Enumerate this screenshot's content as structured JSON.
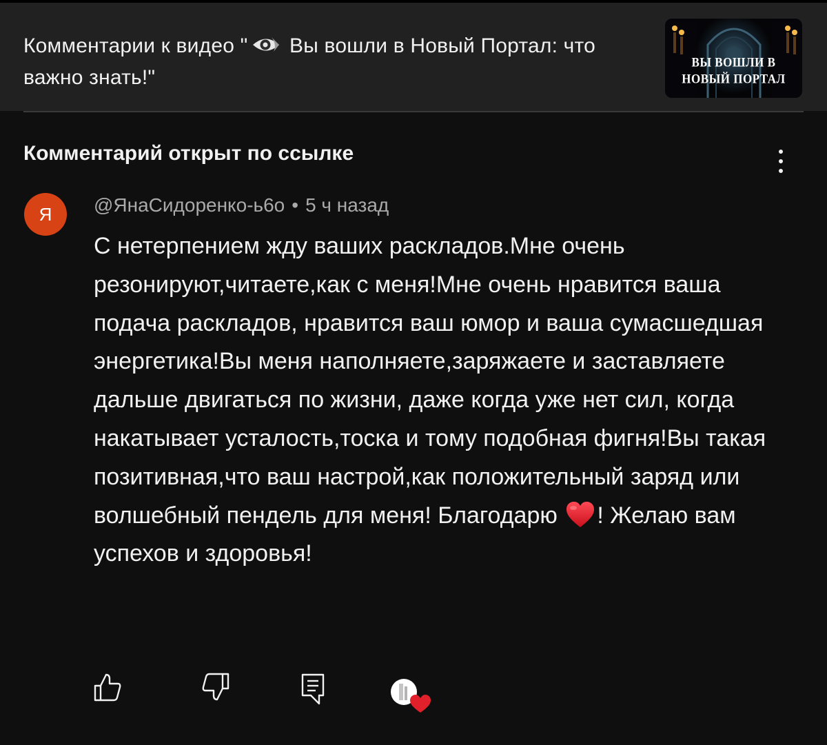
{
  "header": {
    "title_before_icon": "Комментарии к видео \"",
    "title_after_icon": " Вы вошли в Новый Портал: что важно знать!\"",
    "title_icon": "eye-icon",
    "thumbnail_line1": "ВЫ ВОШЛИ В",
    "thumbnail_line2": "НОВЫЙ ПОРТАЛ"
  },
  "section": {
    "linked_label": "Комментарий открыт по ссылке"
  },
  "comment": {
    "avatar_letter": "Я",
    "avatar_color": "#d84315",
    "author": "@ЯнаСидоренко-ь6о",
    "separator": "•",
    "time": "5 ч назад",
    "text_before_heart": "С нетерпением жду ваших раскладов.Мне очень резонируют,читаете,как с меня!Мне очень нравится ваша подача раскладов, нравится ваш юмор и ваша сумасшедшая энергетика!Вы меня наполняете,заряжаете и заставляете дальше двигаться по жизни, даже когда уже нет сил, когда накатывает усталость,тоска и тому подобная фигня!Вы такая позитивная,что ваш настрой,как положительный заряд или волшебный пендель для меня! Благодарю ",
    "inline_icon": "heart-emoji-icon",
    "text_after_heart": "! Желаю вам успехов и здоровья!"
  },
  "actions": {
    "icons": [
      "thumbs-up-icon",
      "thumbs-down-icon",
      "reply-icon",
      "creator-heart-icon"
    ]
  },
  "colors": {
    "background": "#0f0f0f",
    "header_background": "#212121",
    "text_primary": "#f1f1f1",
    "text_secondary": "#aaaaaa",
    "heart": "#e0212c"
  }
}
